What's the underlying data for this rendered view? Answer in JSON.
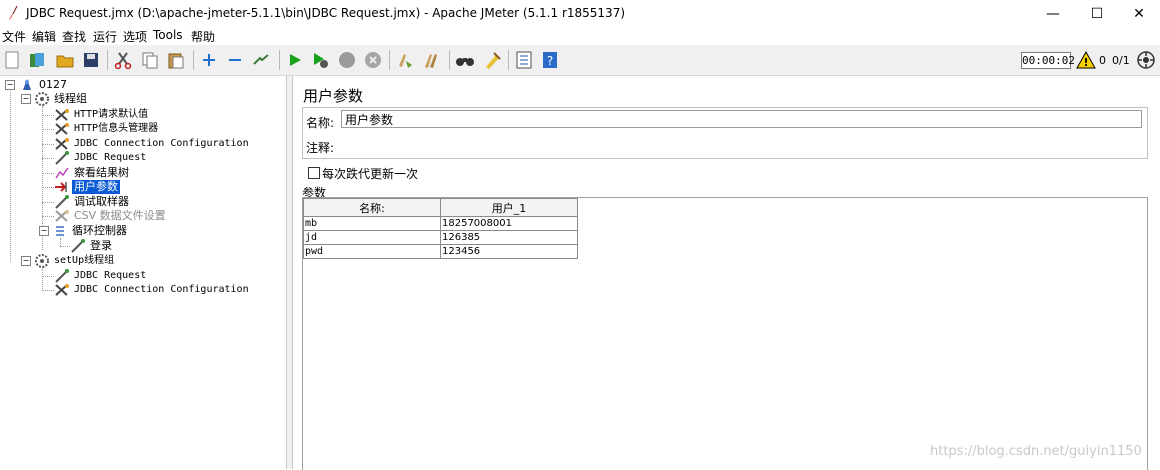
{
  "window": {
    "title": "JDBC Request.jmx (D:\\apache-jmeter-5.1.1\\bin\\JDBC Request.jmx) - Apache JMeter (5.1.1 r1855137)",
    "minimize": "—",
    "maximize": "☐",
    "close": "✕"
  },
  "menu": [
    "文件",
    "编辑",
    "查找",
    "运行",
    "选项",
    "Tools",
    "帮助"
  ],
  "toolbar": {
    "timer": "00:00:02",
    "warnings": "0",
    "threads": "0/1"
  },
  "tree": {
    "root": "0127",
    "thread_group": "线程组",
    "items": [
      "HTTP请求默认值",
      "HTTP信息头管理器",
      "JDBC Connection Configuration",
      "JDBC Request",
      "察看结果树",
      "用户参数",
      "调试取样器",
      "CSV 数据文件设置",
      "循环控制器",
      "登录"
    ],
    "setup_group": "setUp线程组",
    "setup_items": [
      "JDBC Request",
      "JDBC Connection Configuration"
    ]
  },
  "panel": {
    "title": "用户参数",
    "name_label": "名称:",
    "name_value": "用户参数",
    "comment_label": "注释:",
    "iteration_label": "每次跌代更新一次",
    "params_label": "参数",
    "table": {
      "headers": [
        "名称:",
        "用户_1"
      ],
      "rows": [
        [
          "mb",
          "18257008001"
        ],
        [
          "jd",
          "126385"
        ],
        [
          "pwd",
          "123456"
        ]
      ]
    }
  },
  "watermark": "https://blog.csdn.net/guiyin1150"
}
